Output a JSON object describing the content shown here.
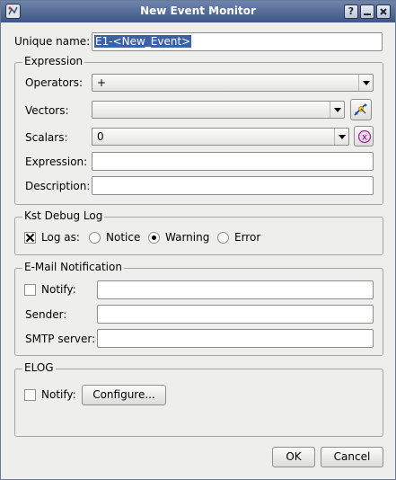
{
  "window": {
    "title": "New Event Monitor",
    "buttons": {
      "help": "?",
      "minimize": "_",
      "close": "X"
    }
  },
  "unique_name": {
    "label": "Unique name:",
    "value": "E1-<New_Event>"
  },
  "expression_group": {
    "title": "Expression",
    "operators": {
      "label": "Operators:",
      "value": "+"
    },
    "vectors": {
      "label": "Vectors:",
      "value": ""
    },
    "scalars": {
      "label": "Scalars:",
      "value": "0"
    },
    "expression": {
      "label": "Expression:",
      "value": ""
    },
    "description": {
      "label": "Description:",
      "value": ""
    }
  },
  "debug_group": {
    "title": "Kst Debug Log",
    "log_as": {
      "label": "Log as:",
      "checked": true
    },
    "options": [
      {
        "label": "Notice",
        "selected": false
      },
      {
        "label": "Warning",
        "selected": true
      },
      {
        "label": "Error",
        "selected": false
      }
    ]
  },
  "email_group": {
    "title": "E-Mail Notification",
    "notify": {
      "label": "Notify:",
      "checked": false,
      "value": ""
    },
    "sender": {
      "label": "Sender:",
      "value": ""
    },
    "smtp": {
      "label": "SMTP server:",
      "value": ""
    }
  },
  "elog_group": {
    "title": "ELOG",
    "notify": {
      "label": "Notify:",
      "checked": false
    },
    "configure_label": "Configure..."
  },
  "footer": {
    "ok_label": "OK",
    "cancel_label": "Cancel"
  },
  "colors": {
    "titlebar": "#4a6190",
    "selection": "#3d61a6",
    "background": "#eeeeec"
  }
}
